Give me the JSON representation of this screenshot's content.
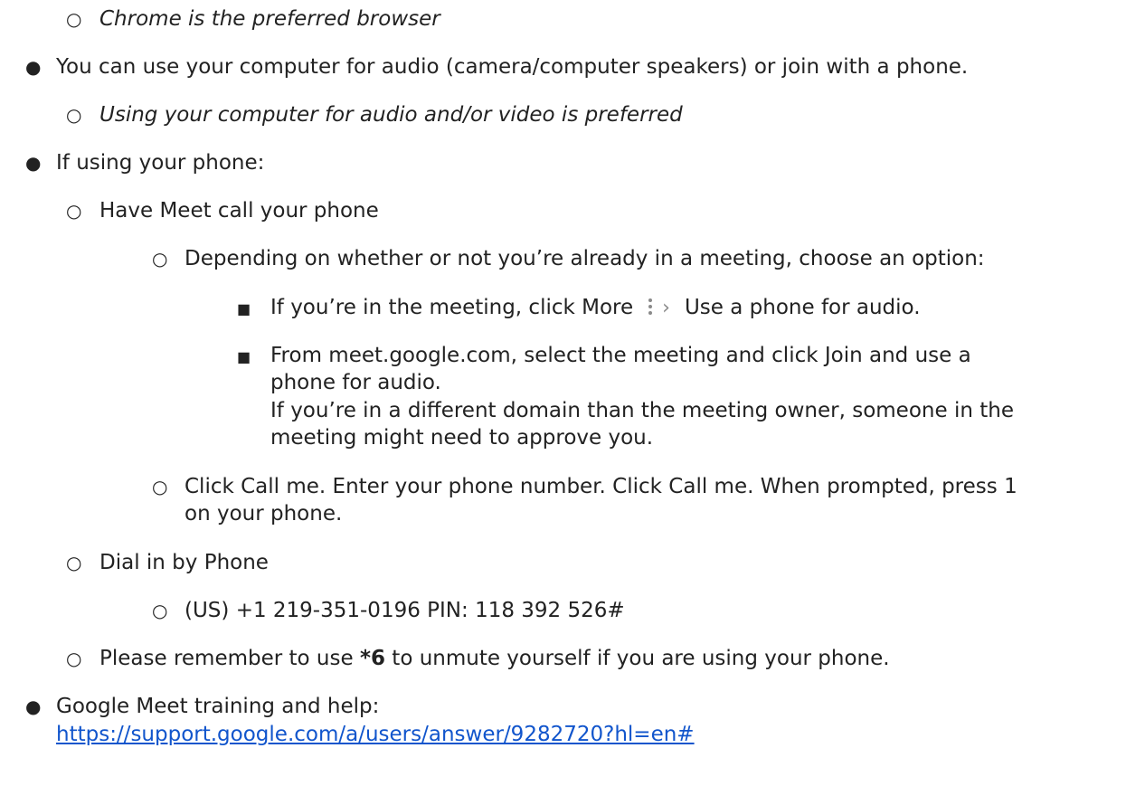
{
  "lines": {
    "l0": "Chrome is the preferred browser",
    "l1": "You can use your computer for audio (camera/computer speakers) or join with a phone.",
    "l2": "Using your computer for audio and/or video is preferred",
    "l3": "If using your phone:",
    "l4": "Have Meet call your phone",
    "l5": "Depending on whether or not you’re already in a meeting, choose an option:",
    "l6a": "If you’re in the meeting, click More",
    "l6b": "Use a phone for audio.",
    "l7a": "From meet.google.com, select the meeting and click Join and use a",
    "l7b": "phone for audio.",
    "l7c": "If you’re in a different domain than the meeting owner, someone in the",
    "l7d": "meeting might need to approve you.",
    "l8a": "Click Call me. Enter your phone number. Click Call me. When prompted, press 1",
    "l8b": "on your phone.",
    "l9": "Dial in by Phone",
    "l10": "(US) +1 219-351-0196 PIN: 118 392 526#",
    "l11a": "Please remember to use ",
    "l11b": "*6",
    "l11c": " to unmute yourself if you are using your phone.",
    "l12": "Google Meet training and help:",
    "link": "https://support.google.com/a/users/answer/9282720?hl=en#"
  },
  "bullets": {
    "disc": "●",
    "circle": "○",
    "square": "■"
  },
  "icons": {
    "more": "more-vert-icon",
    "chevron": "chevron-right-icon"
  },
  "colors": {
    "text": "#222222",
    "link": "#1155cc",
    "icon": "#8a8a8a"
  }
}
